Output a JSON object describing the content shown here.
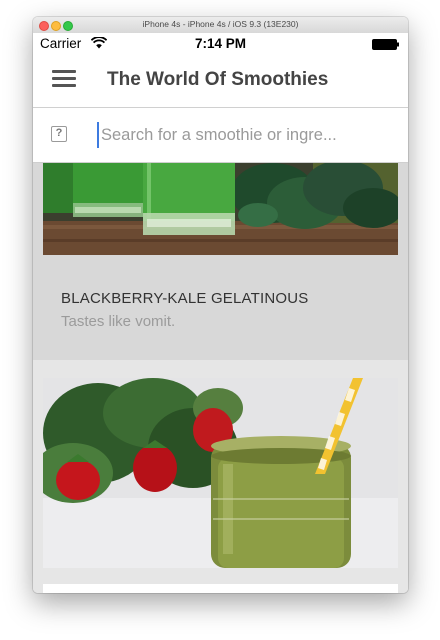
{
  "simulator": {
    "title": "iPhone 4s - iPhone 4s / iOS 9.3 (13E230)"
  },
  "status_bar": {
    "carrier": "Carrier",
    "time": "7:14 PM",
    "wifi_icon": "wifi-icon",
    "battery_icon": "battery-icon"
  },
  "header": {
    "title": "The World Of Smoothies",
    "menu_icon": "hamburger-menu-icon"
  },
  "search": {
    "placeholder": "Search for a smoothie or ingre...",
    "value": "",
    "icon": "missing-image-icon"
  },
  "recipes": [
    {
      "title": "BLACKBERRY-KALE GELATINOUS",
      "subtitle": "Tastes like vomit."
    }
  ],
  "colors": {
    "accent": "#3d7be0",
    "header_text": "#444444",
    "card_bg": "#d8d8d8",
    "subtitle_text": "#9b9b9b"
  }
}
